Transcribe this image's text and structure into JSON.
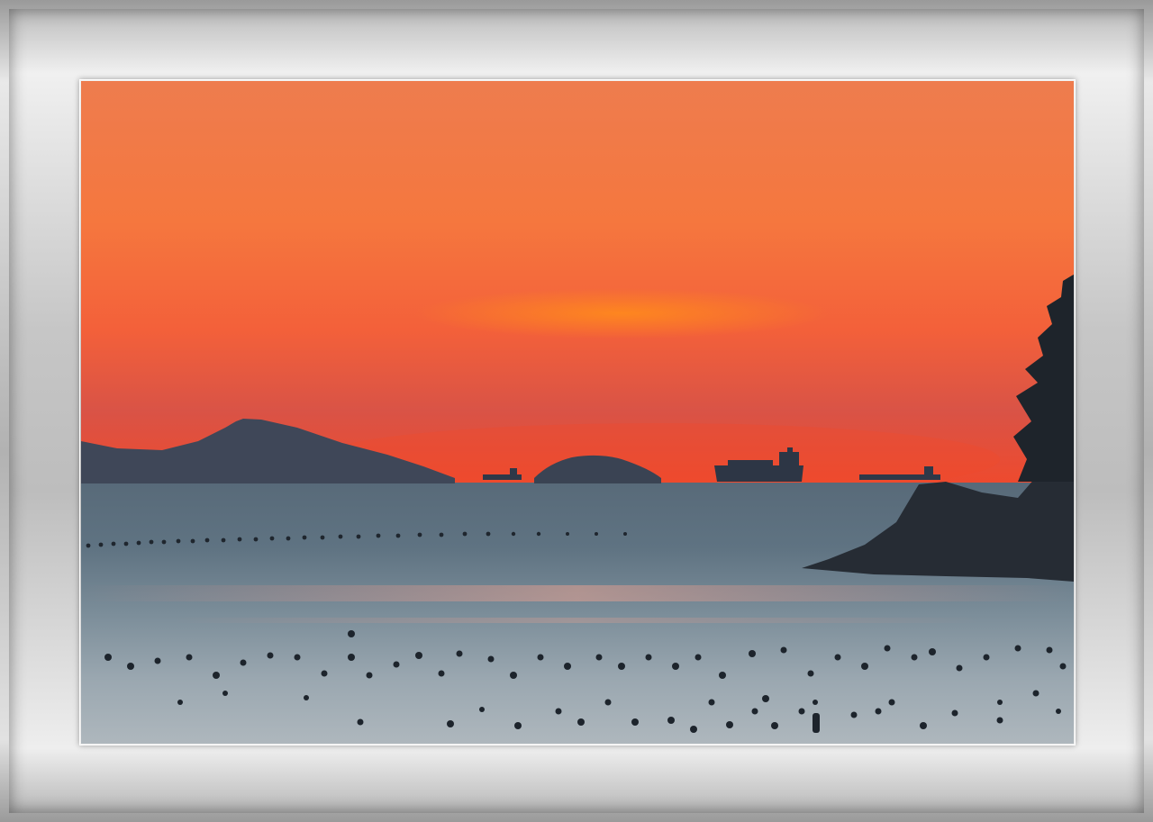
{
  "scene": {
    "description_icons": [
      "sunset-sky",
      "mountain-silhouette",
      "island-silhouette",
      "cargo-ship-icon",
      "tanker-ship-icon",
      "tree-silhouette",
      "rocky-headland",
      "buoy-markers"
    ],
    "colors": {
      "sky_top": "#ef7f4a",
      "sky_mid": "#f5763c",
      "sky_horizon": "#ec4a32",
      "glow": "#ff8a1e",
      "haze": "#c95a4f",
      "sea_top": "#4f6473",
      "sea_mid": "#6f8492",
      "sea_bottom": "#a9b3b9",
      "silhouette": "#2d3644",
      "mountain": "#3e4656",
      "frame": "#c4c4c4"
    }
  }
}
